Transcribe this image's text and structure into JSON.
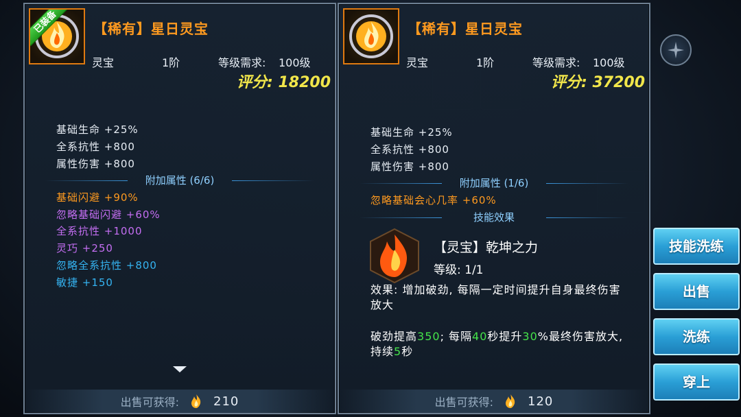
{
  "left_card": {
    "equipped_badge": "已装备",
    "title": "【稀有】星日灵宝",
    "type": "灵宝",
    "tier": "1阶",
    "level_req_label": "等级需求:",
    "level_req_value": "100级",
    "score": "评分: 18200",
    "base_stats": [
      "基础生命  +25%",
      "全系抗性  +800",
      "属性伤害  +800"
    ],
    "extra_title": "附加属性 (6/6)",
    "extra_stats": [
      {
        "text": "基础闪避  +90%",
        "color": "#ff9a1f"
      },
      {
        "text": "忽略基础闪避  +60%",
        "color": "#c46ef2"
      },
      {
        "text": "全系抗性  +1000",
        "color": "#c46ef2"
      },
      {
        "text": "灵巧  +250",
        "color": "#c46ef2"
      },
      {
        "text": "忽略全系抗性  +800",
        "color": "#35b4f2"
      },
      {
        "text": "敏捷  +150",
        "color": "#35b4f2"
      }
    ],
    "sell_label": "出售可获得:",
    "sell_value": "210"
  },
  "right_card": {
    "title": "【稀有】星日灵宝",
    "type": "灵宝",
    "tier": "1阶",
    "level_req_label": "等级需求:",
    "level_req_value": "100级",
    "score": "评分: 37200",
    "base_stats": [
      "基础生命  +25%",
      "全系抗性  +800",
      "属性伤害  +800"
    ],
    "extra_title": "附加属性 (1/6)",
    "extra_stats": [
      {
        "text": "忽略基础会心几率  +60%",
        "color": "#ff9a1f"
      }
    ],
    "skill_section_title": "技能效果",
    "skill_name": "【灵宝】乾坤之力",
    "skill_level": "等级: 1/1",
    "effect_text": "效果: 增加破劲, 每隔一定时间提升自身最终伤害放大",
    "detail": {
      "p1": "破劲提高",
      "n1": "350",
      "p2": "; 每隔",
      "n2": "40",
      "p3": "秒提升",
      "n3": "30",
      "p4": "%最终伤害放大, 持续",
      "n4": "5",
      "p5": "秒"
    },
    "sell_label": "出售可获得:",
    "sell_value": "120"
  },
  "actions": [
    "技能洗练",
    "出售",
    "洗练",
    "穿上"
  ],
  "icons": [
    "spirit-treasure-flame-icon",
    "skill-fire-icon",
    "currency-flame-icon",
    "scroll-down-arrow-icon"
  ]
}
